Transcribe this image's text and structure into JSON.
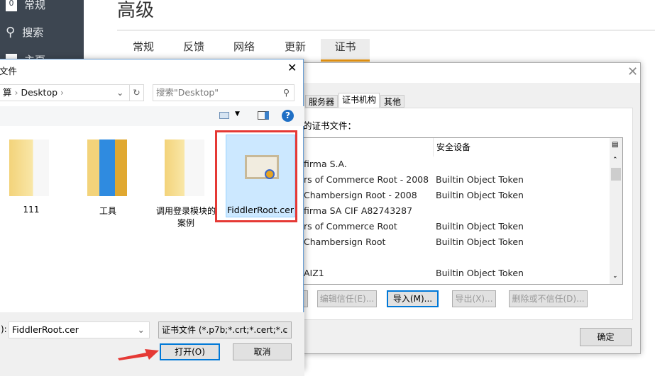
{
  "app": {
    "sidebar": [
      {
        "label": "常规",
        "icon": "general-icon"
      },
      {
        "label": "搜索",
        "icon": "search-icon"
      },
      {
        "label": "主页",
        "icon": "home-icon"
      }
    ],
    "title": "高级",
    "tabs": [
      "常规",
      "反馈",
      "网络",
      "更新",
      "证书"
    ],
    "selected_tab": "证书",
    "accent": "#f39c12"
  },
  "cert_dialog": {
    "tabs": [
      "服务器",
      "证书机构",
      "其他"
    ],
    "selected_tab": "证书机构",
    "label": "的证书文件：",
    "column_security": "安全设备",
    "rows": [
      [
        "firma S.A.",
        ""
      ],
      [
        "rs of Commerce Root - 2008",
        "Builtin Object Token"
      ],
      [
        "Chambersign Root - 2008",
        "Builtin Object Token"
      ],
      [
        "firma SA CIF A82743287",
        ""
      ],
      [
        "rs of Commerce Root",
        "Builtin Object Token"
      ],
      [
        "Chambersign Root",
        "Builtin Object Token"
      ],
      [
        "",
        ""
      ],
      [
        "AIZ1",
        "Builtin Object Token"
      ]
    ],
    "buttons": {
      "edit": "编辑信任(E)...",
      "import": "导入(M)...",
      "export": "导出(X)...",
      "delete": "删除或不信任(D)..."
    },
    "ok": "确定"
  },
  "file_dialog": {
    "title": "文件",
    "path": [
      "算",
      "Desktop"
    ],
    "search_placeholder": "搜索\"Desktop\"",
    "items": [
      {
        "name": "111"
      },
      {
        "name": "工具"
      },
      {
        "name": "调用登录模块的案例"
      },
      {
        "name": "FiddlerRoot.cer",
        "selected": true
      }
    ],
    "filename_label": "):",
    "filename": "FiddlerRoot.cer",
    "filter": "证书文件 (*.p7b;*.crt;*.cert;*.c",
    "open": "打开(O)",
    "cancel": "取消",
    "highlight_color": "#e53935"
  }
}
